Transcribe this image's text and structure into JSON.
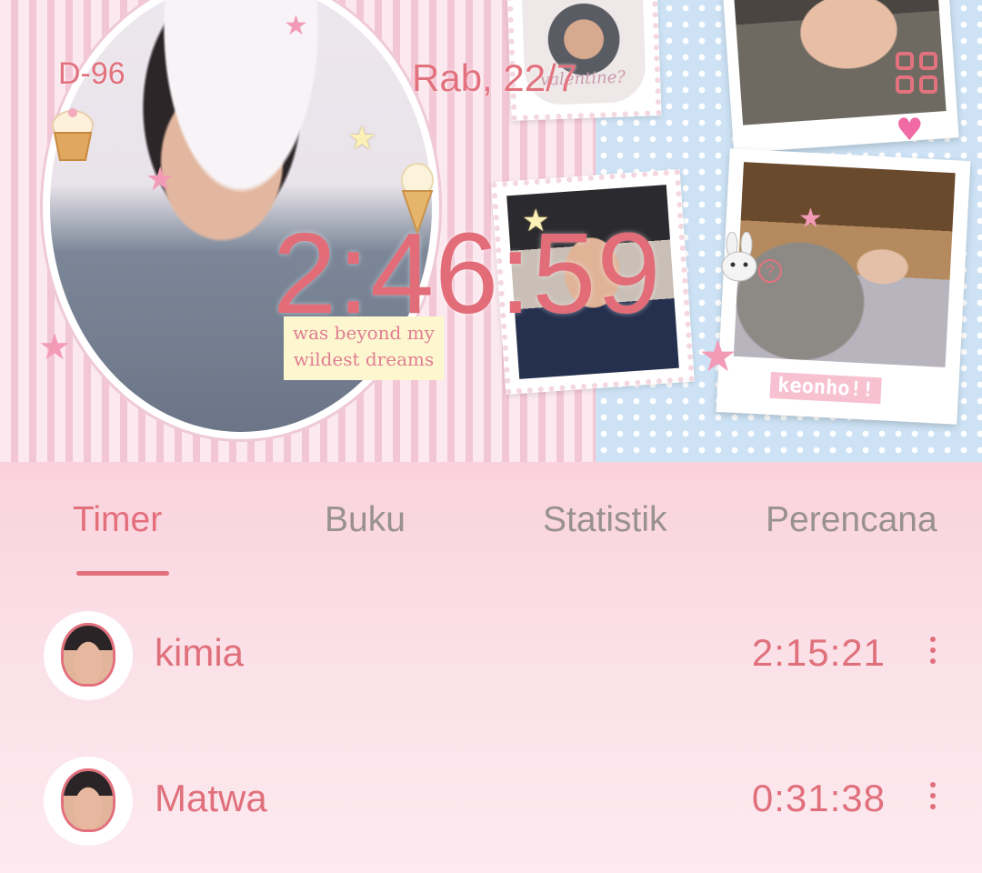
{
  "header": {
    "dday": "D-96",
    "date": "Rab, 22/7",
    "total_time": "2:46:59",
    "help_glyph": "?",
    "grid_icon": "grid-menu-icon",
    "collage": {
      "caption": "was beyond my wildest dreams",
      "stamp_text": "valentine?",
      "polaroid_label": "keonho!!"
    }
  },
  "tabs": [
    {
      "label": "Timer",
      "active": true
    },
    {
      "label": "Buku",
      "active": false
    },
    {
      "label": "Statistik",
      "active": false
    },
    {
      "label": "Perencana",
      "active": false
    }
  ],
  "subjects": [
    {
      "name": "kimia",
      "time": "2:15:21",
      "more_icon": "more-vertical-icon"
    },
    {
      "name": "Matwa",
      "time": "0:31:38",
      "more_icon": "more-vertical-icon"
    }
  ],
  "colors": {
    "accent": "#e26f7b",
    "tab_inactive": "#999191",
    "stripe_pink": "#f3c6d5",
    "dot_blue": "#cde3f5"
  }
}
